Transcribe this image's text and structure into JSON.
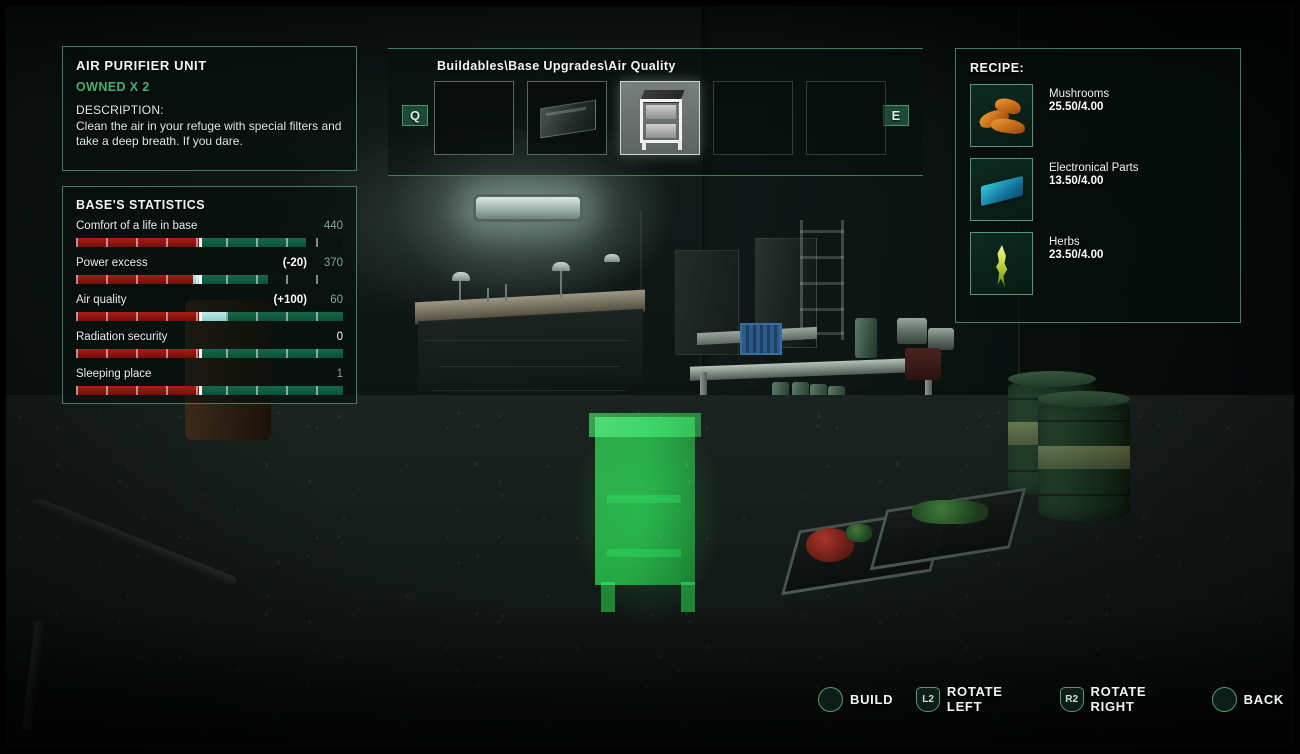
{
  "info_panel": {
    "title": "AIR PURIFIER UNIT",
    "owned": "OWNED X 2",
    "description_label": "DESCRIPTION:",
    "description": "Clean the air in your refuge with special filters and take a deep breath. If you dare."
  },
  "stats_panel": {
    "title": "BASE'S STATISTICS",
    "rows": [
      {
        "name": "Comfort of a life in base",
        "delta": "",
        "value": "440",
        "value_style": "dim",
        "neg_pct": 46,
        "pos_pct": 40,
        "gain_pct": 0,
        "gain_start": 0
      },
      {
        "name": "Power excess",
        "delta": "(-20)",
        "value": "370",
        "value_style": "dim",
        "neg_pct": 46,
        "pos_pct": 26,
        "gain_pct": 2,
        "gain_start": 44
      },
      {
        "name": "Air quality",
        "delta": "(+100)",
        "value": "60",
        "value_style": "dim",
        "neg_pct": 46,
        "pos_pct": 54,
        "gain_pct": 9,
        "gain_start": 47
      },
      {
        "name": "Radiation security",
        "delta": "",
        "value": "0",
        "value_style": "bright",
        "neg_pct": 46,
        "pos_pct": 54,
        "gain_pct": 0,
        "gain_start": 0
      },
      {
        "name": "Sleeping place",
        "delta": "",
        "value": "1",
        "value_style": "dim",
        "neg_pct": 46,
        "pos_pct": 54,
        "gain_pct": 0,
        "gain_start": 0
      }
    ]
  },
  "buildables": {
    "breadcrumb": "Buildables\\Base Upgrades\\Air Quality",
    "prev_key": "Q",
    "next_key": "E",
    "slots": [
      {
        "id": "slot-1",
        "state": "empty",
        "selected": false
      },
      {
        "id": "slot-2",
        "state": "item-generator",
        "selected": false
      },
      {
        "id": "slot-3",
        "state": "item-air-purifier",
        "selected": true
      },
      {
        "id": "slot-4",
        "state": "empty",
        "selected": false
      },
      {
        "id": "slot-5",
        "state": "empty",
        "selected": false
      }
    ]
  },
  "recipe_panel": {
    "title": "RECIPE:",
    "ingredients": [
      {
        "name": "Mushrooms",
        "amount": "25.50/4.00",
        "icon": "mushrooms-icon"
      },
      {
        "name": "Electronical Parts",
        "amount": "13.50/4.00",
        "icon": "electronical-parts-icon"
      },
      {
        "name": "Herbs",
        "amount": "23.50/4.00",
        "icon": "herbs-icon"
      }
    ]
  },
  "prompts": [
    {
      "button": "circle",
      "glyph": "",
      "label": "BUILD"
    },
    {
      "button": "shoulder",
      "glyph": "L2",
      "label": "ROTATE LEFT"
    },
    {
      "button": "shoulder",
      "glyph": "R2",
      "label": "ROTATE RIGHT"
    },
    {
      "button": "circle",
      "glyph": "",
      "label": "BACK"
    }
  ],
  "colors": {
    "accent_green": "#3fb46f",
    "panel_border": "#3f7d5c",
    "bar_positive": "#14694a",
    "bar_negative": "#b01b15",
    "bar_gain": "#bfe9e4",
    "hologram": "#24dc46"
  }
}
